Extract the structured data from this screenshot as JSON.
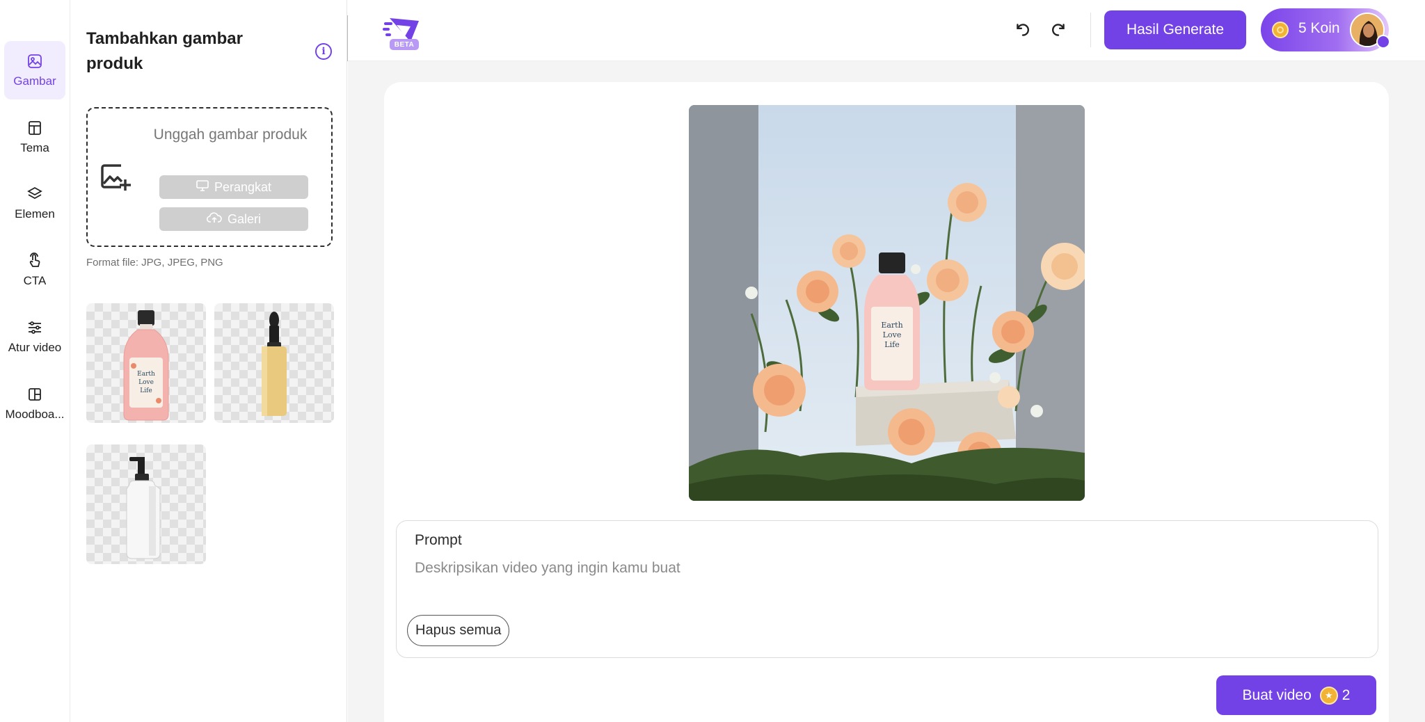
{
  "sidebar": {
    "items": [
      {
        "label": "Gambar",
        "icon": "image-icon",
        "active": true
      },
      {
        "label": "Tema",
        "icon": "layout-icon",
        "active": false
      },
      {
        "label": "Elemen",
        "icon": "layers-icon",
        "active": false
      },
      {
        "label": "CTA",
        "icon": "pointer-icon",
        "active": false
      },
      {
        "label": "Atur video",
        "icon": "sliders-icon",
        "active": false
      },
      {
        "label": "Moodboa...",
        "icon": "moodboard-icon",
        "active": false
      }
    ]
  },
  "panel": {
    "title": "Tambahkan gambar produk",
    "upload": {
      "text": "Unggah gambar produk",
      "device_button": "Perangkat",
      "gallery_button": "Galeri"
    },
    "format_note": "Format file: JPG, JPEG, PNG"
  },
  "topbar": {
    "logo_badge": "BETA",
    "results_button": "Hasil Generate",
    "coins_label": "5 Koin"
  },
  "prompt": {
    "label": "Prompt",
    "placeholder": "Deskripsikan video yang ingin kamu buat",
    "value": "",
    "clear_button": "Hapus semua"
  },
  "create_button": {
    "label": "Buat video",
    "cost": "2"
  },
  "colors": {
    "accent": "#7342e6",
    "coin": "#f2b233"
  }
}
